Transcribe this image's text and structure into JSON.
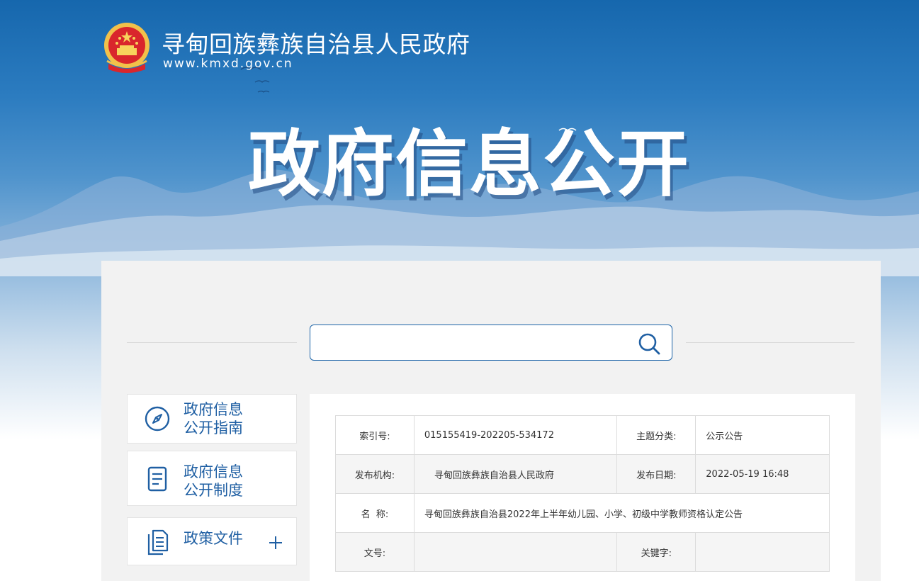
{
  "header": {
    "site_name": "寻甸回族彝族自治县人民政府",
    "site_url": "www.kmxd.gov.cn",
    "banner_title": "政府信息公开",
    "emblem_icon": "national-emblem-icon"
  },
  "search": {
    "value": "",
    "icon": "search-icon"
  },
  "sidebar": {
    "items": [
      {
        "label_line1": "政府信息",
        "label_line2": "公开指南",
        "icon": "compass-icon"
      },
      {
        "label_line1": "政府信息",
        "label_line2": "公开制度",
        "icon": "document-icon"
      },
      {
        "label": "政策文件",
        "icon": "files-icon",
        "expand_icon": "plus-icon"
      }
    ]
  },
  "meta_table": {
    "rows": [
      {
        "k1": "索引号:",
        "v1": "015155419-202205-534172",
        "k2": "主题分类:",
        "v2": "公示公告"
      },
      {
        "k1": "发布机构:",
        "v1": "寻甸回族彝族自治县人民政府",
        "k2": "发布日期:",
        "v2": "2022-05-19 16:48"
      },
      {
        "k1": "名  称:",
        "v1": "寻甸回族彝族自治县2022年上半年幼儿园、小学、初级中学教师资格认定公告"
      },
      {
        "k1": "文号:",
        "v1": "",
        "k2": "关键字:",
        "v2": ""
      }
    ]
  },
  "colors": {
    "primary_blue": "#1f5fa3",
    "banner_top": "#1667ad",
    "panel_bg": "#f2f2f2"
  }
}
